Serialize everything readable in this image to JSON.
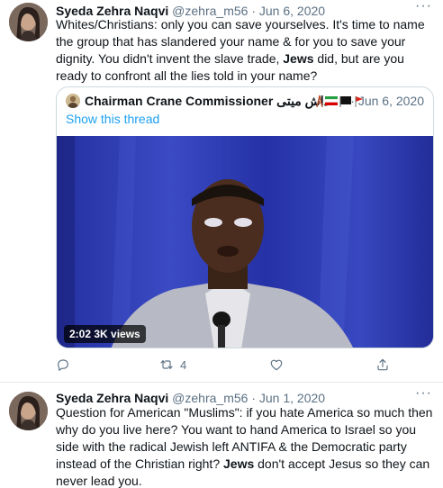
{
  "tweet1": {
    "author_name": "Syeda Zehra Naqvi",
    "handle": "@zehra_m56",
    "separator": "·",
    "date": "Jun 6, 2020",
    "more": "···",
    "text_parts": [
      "Whites/Christians: only you can save yourselves. It's time to name the group that has slandered your name & for you to save your dignity. You didn't invent the slave trade, ",
      "Jews",
      " did, but are you ready to confront all the lies told in your name?"
    ],
    "quote": {
      "author_name": "Chairman Crane Commissioner داش میتی",
      "separator": "·",
      "date": "Jun 6, 2020",
      "show_thread": "Show this thread",
      "video_badge": "2:02  3K views"
    },
    "actions": {
      "reply_count": "",
      "retweet_count": "4",
      "like_count": "",
      "share_count": ""
    }
  },
  "tweet2": {
    "author_name": "Syeda Zehra Naqvi",
    "handle": "@zehra_m56",
    "separator": "·",
    "date": "Jun 1, 2020",
    "more": "···",
    "text_parts": [
      "Question for American \"Muslims\": if you hate America so much then why do you live here? You want to hand America to Israel so you side with the radical Jewish left ANTIFA & the Democratic party instead of the Christian right? ",
      "Jews",
      " don't accept Jesus so they can never lead you."
    ]
  }
}
